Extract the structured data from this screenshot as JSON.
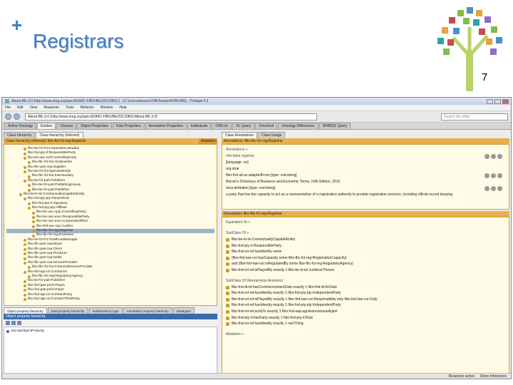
{
  "slide": {
    "title": "Registrars",
    "page_number": "7"
  },
  "app": {
    "window_title": "About-BE-3.0 (http://www.omg.org/spec/EDMC-FIBO/BE/20130801/) : [C:\\Users\\eleanor\\FIBO\\export\\FIBO\\BE] - Protégé 4.3",
    "menu": [
      "File",
      "Edit",
      "View",
      "Reasoner",
      "Tools",
      "Refactor",
      "Window",
      "Help"
    ],
    "ontology_select": "About-BE-3.0 (http://www.omg.org/spec/EDMC-FIBO/BE/20130801/About-BE-3.0)",
    "search_placeholder": "Search for entity",
    "tabs": [
      "Active Ontology",
      "Entities",
      "Classes",
      "Object Properties",
      "Data Properties",
      "Annotation Properties",
      "Individuals",
      "OWLViz",
      "DL Query",
      "OntoGraf",
      "Ontology Differences",
      "SPARQL Query"
    ],
    "active_tab": "Entities",
    "left": {
      "subtabs": [
        "Class hierarchy",
        "Class hierarchy (inferred)"
      ],
      "header": "Class hierarchy (inferred): fibo-fbc-fct-reg:Registrar",
      "header_right": "Asserted",
      "tree": [
        "fibo-be-fct-fct:CorporateCustodian",
        "fibo-fnd-pty-rl:ResponsibleParty",
        "fibo-be-oac-cctl:ControllingParty",
        "fibo-fbc-fct-fse:Underwriter",
        "fibo-fbc-pas-caa:Supplier",
        "fibo-be-fct-fct:OperatorEntity",
        "fibo-fbc-fct-fse:Intermediary",
        "fibo-be-fct-pub:Publisher",
        "fibo-be-fct-pub:PublishingHouse",
        "fibo-be-fct-pub:Publisher",
        "fibo-be-le-lei:ContractuallyCapableEntity",
        "fibo-fnd-pty-pty:PartyInRole",
        "fibo-fnd-pty-rl:Signatory",
        "fibo-fnd-pty-pty:Affiliate",
        "fibo-be-oac-cpty:ControllingParty",
        "fibo-be-oac-exec:ResponsibleParty",
        "fibo-be-oac-exec:CorporateOfficer",
        "fibo-fnd-oac-oac:Auditor",
        "fibo-fbc-fct-reg:Registrar",
        "fibo-fbc-fct-reg:Examiner",
        "fibo-be-fct-fct:TrustFundManager",
        "fibo-fbc-pas-caa:Buyer",
        "fibo-fbc-pas-caa:Client",
        "fibo-fbc-pas-caa:Producer",
        "fibo-fbc-pas-caa:Seller",
        "fibo-fbc-pas-caa:ServiceProvider",
        "fibo-fbc-fct-fse:FinancialServiceProvider",
        "fibo-fnd-agr-ctr:Contractor",
        "fibo-fbc-fct-reg:RegulatoryAgency",
        "fibo-be-fct-pub:Publisher",
        "fibo-fnd-pas-psch:Payee",
        "fibo-fnd-pas-psch:Payer",
        "fibo-fnd-agr-ctr:ContractParty",
        "fibo-fnd-agr-ctr:ContractThirdParty"
      ],
      "selected_index": 18,
      "bottom_tabs": [
        "Object property hierarchy",
        "Data property hierarchy",
        "Individuals by type",
        "Annotation property hierarchy",
        "Datatypes"
      ],
      "obj_header": "Object property hierarchy",
      "obj_root": "owl:topObjectProperty"
    },
    "right": {
      "subtabs": [
        "Class Annotations",
        "Class Usage"
      ],
      "ann_header": "Annotations: fibo-fbc-fct-reg:Registrar",
      "annotations": [
        {
          "label": "Annotations +",
          "text": ""
        },
        {
          "label": "rdfs:label",
          "text": "registrar"
        },
        {
          "label": "",
          "text": "[language: en]"
        },
        {
          "label": "",
          "text": "reg-strar"
        },
        {
          "label": "",
          "text": "fibo-fnd-utl-av:adaptedFrom   [type: xsd:string]"
        },
        {
          "label": "",
          "text": "Barron's Dictionary of Business and Economic Terms, Fifth Edition, 2012"
        },
        {
          "label": "",
          "text": "skos:definition   [type: xsd:string]"
        },
        {
          "label": "",
          "text": "a party that has the capacity to act as a representative of a registration authority to provide registration services, including official record keeping"
        }
      ],
      "desc_header": "Description: fibo-fbc-fct-reg:Registrar",
      "desc_sections": [
        {
          "label": "Equivalent To +",
          "items": []
        },
        {
          "label": "SubClass Of +",
          "items": [
            "fibo-be-le-lei:ContractuallyCapableEntity",
            "fibo-fnd-pty-rl:ResponsibleParty",
            "fibo-fnd-rel-rel:hasIdentity some",
            "(fibo-fnd-law-cor:hasCapacity some fibo-fbc-fct-reg:RegistrationCapacity)",
            "and (fibo-fnd-law-cor:isRegulatedBy some fibo-fbc-fct-reg:RegulatoryAgency)",
            "fibo-fnd-rel-rel:isPlayedBy exactly 1 fibo-be-le-lei:Juridical Person"
          ]
        },
        {
          "label": "SubClass Of (Anonymous Ancestor)",
          "items": [
            "fibo-fnd-dt-fd:hasCommencementDate exactly 1 fibo-fnd-dt-fd:Date",
            "fibo-fnd-rel-rel:hasIdentity exactly 1 fibo-fnd-pty-pty:IndependentParty",
            "fibo-fnd-rel-rel:isPlayedBy exactly 1 fibo-fnd-law-cor:Responsibility only fibo-fnd-law-cor:Duty",
            "fibo-fnd-rel-rel:hasIdentity exactly 1 fibo-fnd-pty-pty:IndependentParty",
            "fibo-fnd-rel-rel:actsOn exactly 1 fibo-fnd-aap-agt:AutonomousAgent",
            "fibo-fnd-pty-rl:hasParty exactly 1 fibo-fnd-pty-rl:Role",
            "fibo-fnd-rel-rel:hasIdentity exactly 1 owl:Thing"
          ]
        },
        {
          "label": "Members +",
          "items": []
        }
      ],
      "status": [
        "Reasoner active",
        "Show Inferences"
      ]
    }
  },
  "colors": {
    "title_blue": "#3f7ec5",
    "header_orange": "#e8b04a",
    "selection": "#9eb3c9"
  }
}
